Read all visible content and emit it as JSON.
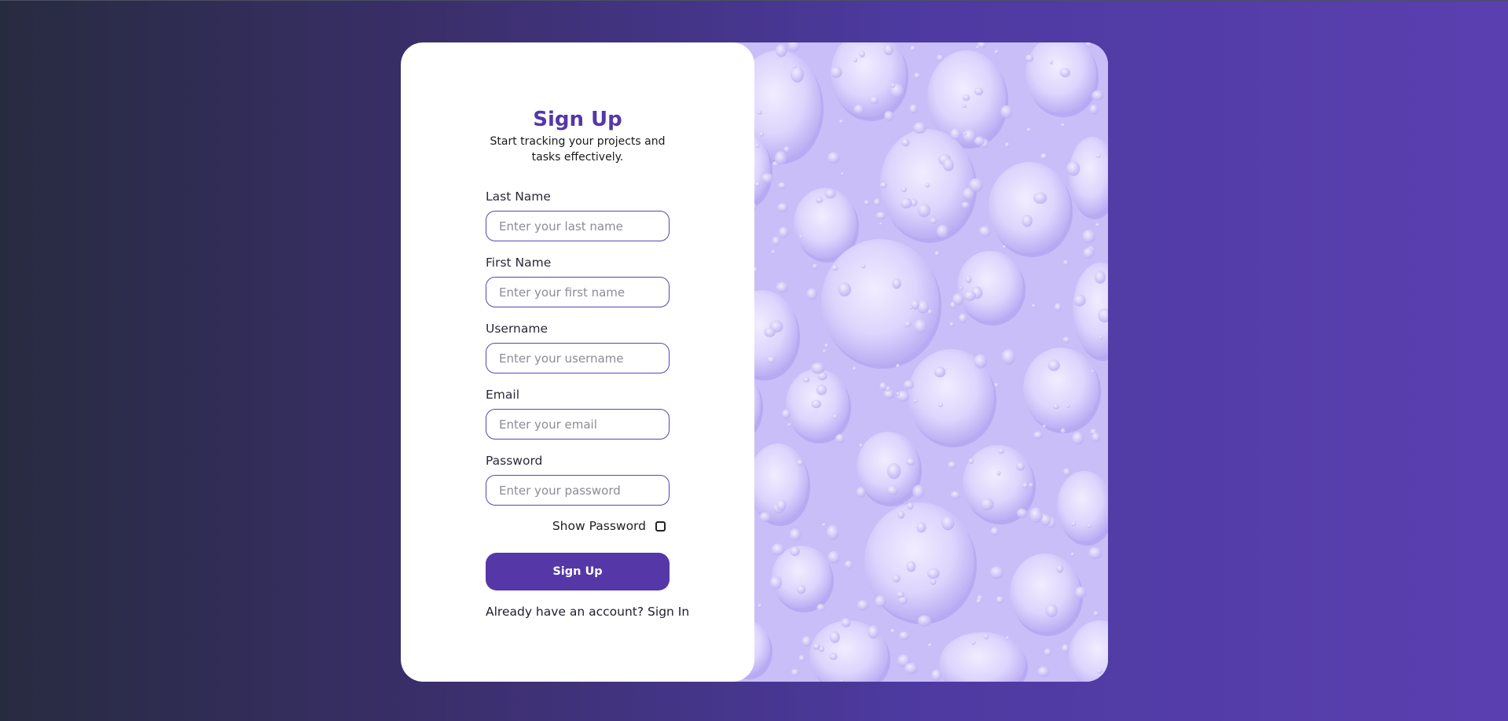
{
  "form": {
    "title": "Sign Up",
    "subtitle": "Start tracking your projects and tasks effectively.",
    "fields": {
      "last_name": {
        "label": "Last Name",
        "placeholder": "Enter your last name"
      },
      "first_name": {
        "label": "First Name",
        "placeholder": "Enter your first name"
      },
      "username": {
        "label": "Username",
        "placeholder": "Enter your username"
      },
      "email": {
        "label": "Email",
        "placeholder": "Enter your email"
      },
      "password": {
        "label": "Password",
        "placeholder": "Enter your password"
      }
    },
    "show_password_label": "Show Password",
    "submit_label": "Sign Up",
    "signin_prompt": "Already have an account?",
    "signin_link": "Sign In"
  },
  "colors": {
    "accent": "#5537a8",
    "input_border": "#5a44b5",
    "image_bg": "#c8bdf7",
    "drop_light": "#e6e0ff",
    "drop_shadow": "#a898ef"
  }
}
